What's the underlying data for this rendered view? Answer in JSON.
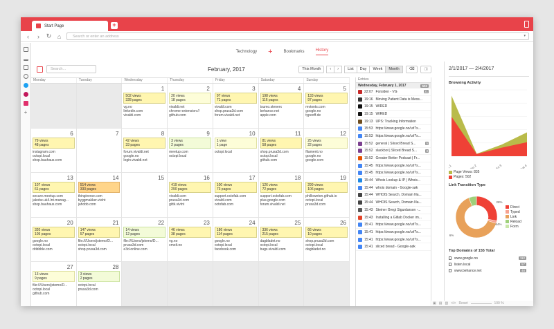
{
  "browser": {
    "tab_title": "Start Page",
    "address_placeholder": "Search or enter an address"
  },
  "topnav": [
    "Technology",
    "Bookmarks",
    "History"
  ],
  "toolbar": {
    "search_placeholder": "Search...",
    "month_title": "February, 2017",
    "this_month": "This Month",
    "views": [
      "List",
      "Day",
      "Week",
      "Month"
    ]
  },
  "calendar": {
    "days_of_week": [
      "Monday",
      "Tuesday",
      "Wednesday",
      "Thursday",
      "Friday",
      "Saturday",
      "Sunday"
    ],
    "cells": [
      {
        "day": "",
        "out": true
      },
      {
        "day": "",
        "out": true
      },
      {
        "day": "1",
        "views": "502 views",
        "pages": "328 pages",
        "color": "yellow",
        "domains": [
          "vg.no",
          "linkedin.com",
          "vivaldi.com"
        ]
      },
      {
        "day": "2",
        "views": "20 views",
        "pages": "18 pages",
        "color": "light",
        "domains": [
          "vivaldi.net",
          "chrome-extension://",
          "github.com"
        ]
      },
      {
        "day": "3",
        "views": "97 views",
        "pages": "71 pages",
        "color": "yellow",
        "domains": [
          "vivaldi.com",
          "shop.prusa3d.com",
          "forum.vivaldi.net"
        ]
      },
      {
        "day": "4",
        "views": "198 views",
        "pages": "116 pages",
        "color": "yellow",
        "domains": [
          "tsumo.stenerx",
          "behance.net",
          "apple.com"
        ]
      },
      {
        "day": "5",
        "views": "133 views",
        "pages": "97 pages",
        "color": "yellow",
        "domains": [
          "mvtonts.com",
          "google.no",
          "typeoff.de"
        ]
      },
      {
        "day": "6",
        "views": "79 views",
        "pages": "48 pages",
        "color": "yellow",
        "domains": [
          "instagram.com",
          "octopi.local",
          "shop.bauhaus.com"
        ]
      },
      {
        "day": "7",
        "out": false
      },
      {
        "day": "8",
        "views": "42 views",
        "pages": "33 pages",
        "color": "yellow",
        "domains": [
          "forum.vivaldi.net",
          "google.no",
          "login.vivaldi.net"
        ]
      },
      {
        "day": "9",
        "views": "3 views",
        "pages": "2 pages",
        "color": "green",
        "domains": [
          "meetup.com",
          "octopi.local"
        ]
      },
      {
        "day": "10",
        "views": "1 view",
        "pages": "1 page",
        "color": "light",
        "domains": [
          "octopi.local"
        ]
      },
      {
        "day": "11",
        "views": "81 views",
        "pages": "58 pages",
        "color": "yellow",
        "domains": [
          "shop.prusa3d.com",
          "octopi.local",
          "github.com"
        ]
      },
      {
        "day": "12",
        "views": "25 views",
        "pages": "22 pages",
        "color": "light",
        "domains": [
          "filament.no",
          "google.no",
          "google.com"
        ]
      },
      {
        "day": "13",
        "views": "107 views",
        "pages": "61 pages",
        "color": "yellow",
        "domains": [
          "secure.meetup.com",
          "jakobe.uk4.lnt-manag...",
          "shop.bauhaus.com"
        ]
      },
      {
        "day": "14",
        "views": "514 views",
        "pages": "333 pages",
        "color": "orange",
        "domains": [
          "thingiverse.com",
          "byggmakker.vivlnt",
          "jahobb.com"
        ]
      },
      {
        "day": "15",
        "out": false
      },
      {
        "day": "16",
        "views": "419 views",
        "pages": "290 pages",
        "color": "yellow",
        "domains": [
          "vivaldi.com",
          "prusa3d.com",
          "gittk.vivlnt"
        ]
      },
      {
        "day": "17",
        "views": "100 views",
        "pages": "73 pages",
        "color": "yellow",
        "domains": [
          "support.octofab.com",
          "vivaldi.com",
          "octofab.com"
        ]
      },
      {
        "day": "18",
        "views": "126 views",
        "pages": "72 pages",
        "color": "yellow",
        "domains": [
          "support.octofab.com",
          "plus.google.com",
          "forum.vivaldi.net"
        ]
      },
      {
        "day": "19",
        "views": "299 views",
        "pages": "106 pages",
        "color": "yellow",
        "domains": [
          "philloweton.github.io",
          "octopi.local",
          "prusa3d.com"
        ]
      },
      {
        "day": "20",
        "views": "320 views",
        "pages": "105 pages",
        "color": "yellow",
        "domains": [
          "google.no",
          "octopi.local",
          "dribbble.com"
        ]
      },
      {
        "day": "21",
        "views": "147 views",
        "pages": "57 pages",
        "color": "yellow",
        "domains": [
          "file:///Users/jstemo/D...",
          "octopi.local",
          "shop.prusa3d.com"
        ]
      },
      {
        "day": "22",
        "views": "14 views",
        "pages": "12 pages",
        "color": "green",
        "domains": [
          "file:///Users/jstemo/D...",
          "prusa3d.com",
          "e3d-online.com"
        ]
      },
      {
        "day": "23",
        "views": "46 views",
        "pages": "38 pages",
        "color": "yellow",
        "domains": [
          "vg.no",
          "cmolt.no"
        ]
      },
      {
        "day": "24",
        "views": "186 views",
        "pages": "114 pages",
        "color": "yellow",
        "domains": [
          "google.no",
          "octopi.local",
          "facebook.com"
        ]
      },
      {
        "day": "25",
        "views": "336 views",
        "pages": "215 pages",
        "color": "yellow",
        "domains": [
          "dagbladet.no",
          "octopi.local",
          "bugs.vivaldi.com"
        ]
      },
      {
        "day": "26",
        "views": "66 views",
        "pages": "10 pages",
        "color": "yellow",
        "domains": [
          "shop.prusa3d.com",
          "octopi.local",
          "dagbladet.no"
        ]
      },
      {
        "day": "27",
        "views": "13 views",
        "pages": "9 pages",
        "color": "light",
        "domains": [
          "file:///Users/jstemo/D...",
          "octopi.local",
          "github.com"
        ]
      },
      {
        "day": "28",
        "views": "3 views",
        "pages": "2 pages",
        "color": "green",
        "domains": [
          "octopi.local",
          "prusa3d.com"
        ]
      },
      {
        "day": "",
        "out": true
      },
      {
        "day": "",
        "out": true
      },
      {
        "day": "",
        "out": true
      },
      {
        "day": "",
        "out": true
      },
      {
        "day": "",
        "out": true
      }
    ]
  },
  "entries": {
    "header": "Entries",
    "day_label": "Wednesday, February 1, 2017",
    "day_count": "502",
    "items": [
      {
        "time": "22:07",
        "title": "Forsiden - VG",
        "count": "21",
        "color": "#c62828"
      },
      {
        "time": "19:16",
        "title": "Moving Patient Data is Mess...",
        "count": "",
        "color": "#333333"
      },
      {
        "time": "19:15",
        "title": "WIRED",
        "count": "",
        "color": "#111111"
      },
      {
        "time": "19:15",
        "title": "WIRED",
        "count": "",
        "color": "#111111"
      },
      {
        "time": "19:13",
        "title": "UPS: Tracking Information",
        "count": "",
        "color": "#6d4c1f"
      },
      {
        "time": "15:53",
        "title": "https://www.google.no/url?s...",
        "count": "",
        "color": "#4285f4"
      },
      {
        "time": "15:53",
        "title": "https://www.google.no/url?s...",
        "count": "",
        "color": "#4285f4"
      },
      {
        "time": "15:52",
        "title": "general | Sliced Bread S...",
        "count": "5",
        "color": "#7b3f8f"
      },
      {
        "time": "15:52",
        "title": "slackbot | Sliced Bread S...",
        "count": "3",
        "color": "#7b3f8f"
      },
      {
        "time": "15:52",
        "title": "Greater Better Podcast | Fr...",
        "count": "",
        "color": "#e65100"
      },
      {
        "time": "15:45",
        "title": "https://www.google.no/url?s...",
        "count": "",
        "color": "#4285f4"
      },
      {
        "time": "15:45",
        "title": "https://www.google.no/url?s...",
        "count": "",
        "color": "#4285f4"
      },
      {
        "time": "15:44",
        "title": "Whois Lookup & IP | Whois...",
        "count": "",
        "color": "#1e88e5"
      },
      {
        "time": "15:44",
        "title": "whois domain - Google-søk",
        "count": "",
        "color": "#4285f4"
      },
      {
        "time": "15:44",
        "title": "WHOIS Search, Domain Na...",
        "count": "",
        "color": "#444444"
      },
      {
        "time": "15:44",
        "title": "WHOIS Search, Domain Na...",
        "count": "",
        "color": "#444444"
      },
      {
        "time": "15:43",
        "title": "Steiner Gregi Sigurdarson -...",
        "count": "",
        "color": "#555555"
      },
      {
        "time": "15:43",
        "title": "Installing a Gitlab Docker im...",
        "count": "",
        "color": "#e24329"
      },
      {
        "time": "15:41",
        "title": "https://www.google.no/url?s...",
        "count": "",
        "color": "#4285f4"
      },
      {
        "time": "15:41",
        "title": "https://www.google.no/url?s...",
        "count": "",
        "color": "#4285f4"
      },
      {
        "time": "15:41",
        "title": "https://www.google.no/url?s...",
        "count": "",
        "color": "#4285f4"
      },
      {
        "time": "15:41",
        "title": "sliced bread - Google-søk",
        "count": "",
        "color": "#4285f4"
      }
    ]
  },
  "right_panel": {
    "range": "2/1/2017 — 2/4/2017",
    "browsing_title": "Browsing Activity",
    "link_title": "Link Transition Type",
    "top_domains_title": "Top Domains of 155 Total",
    "top_domains": [
      {
        "name": "www.google.no",
        "count": "112"
      },
      {
        "name": "listen.local",
        "count": "57"
      },
      {
        "name": "www.behance.net",
        "count": "48"
      }
    ]
  },
  "chart_data": [
    {
      "type": "area",
      "categories": [
        "Wed 1",
        "Thu 2",
        "Fri 3",
        "Sat 4"
      ],
      "series": [
        {
          "name": "Page Views: 835",
          "values": [
            502,
            20,
            97,
            198
          ]
        },
        {
          "name": "Pages: 502",
          "values": [
            328,
            18,
            71,
            116
          ]
        }
      ],
      "ylim": [
        0,
        550
      ]
    },
    {
      "type": "pie",
      "categories": [
        "Direct",
        "Typed",
        "Link",
        "Reload",
        "Form"
      ],
      "values": [
        28,
        2,
        64,
        6,
        0
      ],
      "labels": [
        "28%",
        "6%",
        "64%"
      ]
    }
  ],
  "colors": {
    "accent": "#e8434a",
    "views": "#b9bb4a",
    "pages": "#ef4136"
  },
  "bottombar": {
    "reset": "Reset",
    "zoom": "100 %"
  }
}
